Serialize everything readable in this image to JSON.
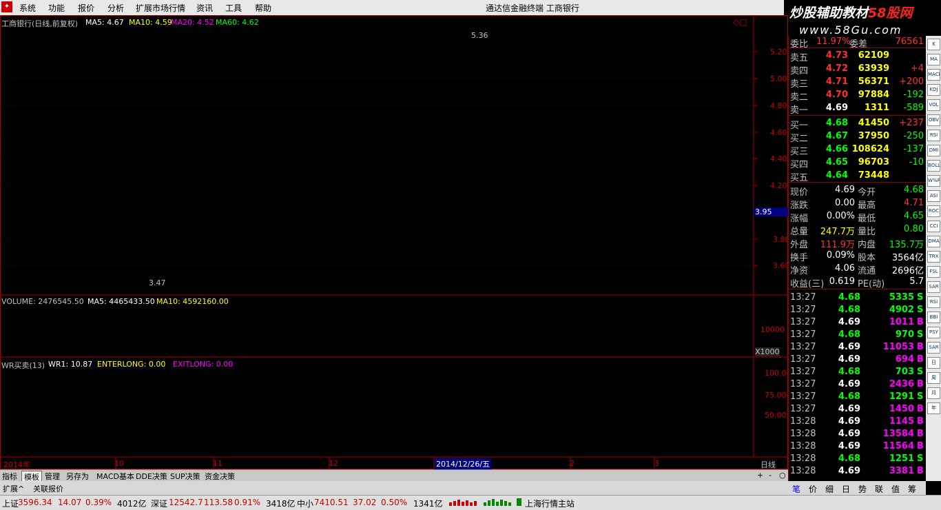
{
  "menu": [
    "系统",
    "功能",
    "报价",
    "分析",
    "扩展市场行情",
    "资讯",
    "工具",
    "帮助"
  ],
  "window_title": "通达信金融终端   工商银行",
  "banner": {
    "line1_a": "炒股辅助教材",
    "line1_b": "58股网",
    "line2": "www.58Gu.com"
  },
  "main_chart": {
    "title": "工商银行(日线,前复权)",
    "ma": [
      {
        "label": "MA5: 4.67",
        "color": "#ffffff"
      },
      {
        "label": "MA10: 4.59",
        "color": "#ffff00"
      },
      {
        "label": "MA20: 4.52",
        "color": "#ff00ff"
      },
      {
        "label": "MA60: 4.62",
        "color": "#00ff00"
      }
    ],
    "high_label": "5.36",
    "low_label": "3.47",
    "price_ticks": [
      "5.20",
      "5.00",
      "4.80",
      "4.60",
      "4.40",
      "4.20",
      "3.80",
      "3.60"
    ],
    "price_marker": "3.95",
    "corner_icons": "◇□"
  },
  "volume": {
    "label": "VOLUME: 2476545.50",
    "ma5": "MA5: 4465433.50",
    "ma10": "MA10: 4592160.00",
    "tick": "10000",
    "unit": "X1000"
  },
  "wr": {
    "title": "WR买卖(13)",
    "wr1": "WR1: 10.87",
    "enter": "ENTERLONG: 0.00",
    "exit": "EXITLONG: 0.00",
    "ticks": [
      "100.0",
      "75.00",
      "50.00"
    ]
  },
  "x_axis": {
    "labels": [
      "2014年",
      "10",
      "11",
      "12",
      "1",
      "2",
      "3"
    ],
    "cursor_date": "2014/12/26/五",
    "period": "日线"
  },
  "tabs": [
    "指标",
    "模板",
    "管理",
    "另存为",
    "MACD基本",
    "DDE决策",
    "SUP决策",
    "资金决策"
  ],
  "zoom": [
    "+",
    "-",
    "○"
  ],
  "ext_tabs": [
    "扩展^",
    "关联报价"
  ],
  "quote": {
    "header": {
      "l1": "委比",
      "v1": "11.97%",
      "l2": "委差",
      "v2": "76561"
    },
    "sells": [
      {
        "label": "卖五",
        "price": "4.73",
        "vol": "62109",
        "chg": ""
      },
      {
        "label": "卖四",
        "price": "4.72",
        "vol": "63939",
        "chg": "+4"
      },
      {
        "label": "卖三",
        "price": "4.71",
        "vol": "56371",
        "chg": "+200"
      },
      {
        "label": "卖二",
        "price": "4.70",
        "vol": "97884",
        "chg": "-192"
      },
      {
        "label": "卖一",
        "price": "4.69",
        "vol": "1311",
        "chg": "-589"
      }
    ],
    "buys": [
      {
        "label": "买一",
        "price": "4.68",
        "vol": "41450",
        "chg": "+237"
      },
      {
        "label": "买二",
        "price": "4.67",
        "vol": "37950",
        "chg": "-250"
      },
      {
        "label": "买三",
        "price": "4.66",
        "vol": "108624",
        "chg": "-137"
      },
      {
        "label": "买四",
        "price": "4.65",
        "vol": "96703",
        "chg": "-10"
      },
      {
        "label": "买五",
        "price": "4.64",
        "vol": "73448",
        "chg": ""
      }
    ],
    "stats": [
      {
        "l1": "现价",
        "v1": "4.69",
        "c1": "#ffffff",
        "l2": "今开",
        "v2": "4.68",
        "c2": "#00ff00"
      },
      {
        "l1": "涨跌",
        "v1": "0.00",
        "c1": "#ffffff",
        "l2": "最高",
        "v2": "4.71",
        "c2": "#ff3030"
      },
      {
        "l1": "涨幅",
        "v1": "0.00%",
        "c1": "#ffffff",
        "l2": "最低",
        "v2": "4.65",
        "c2": "#00ff00"
      },
      {
        "l1": "总量",
        "v1": "247.7万",
        "c1": "#ffff00",
        "l2": "量比",
        "v2": "0.80",
        "c2": "#00ff00"
      },
      {
        "l1": "外盘",
        "v1": "111.9万",
        "c1": "#ff3030",
        "l2": "内盘",
        "v2": "135.7万",
        "c2": "#00ff00"
      },
      {
        "l1": "换手",
        "v1": "0.09%",
        "c1": "#ffffff",
        "l2": "股本",
        "v2": "3564亿",
        "c2": "#ffffff"
      },
      {
        "l1": "净资",
        "v1": "4.06",
        "c1": "#ffffff",
        "l2": "流通",
        "v2": "2696亿",
        "c2": "#ffffff"
      },
      {
        "l1": "收益(三)",
        "v1": "0.619",
        "c1": "#ffffff",
        "l2": "PE(动)",
        "v2": "5.7",
        "c2": "#ffffff"
      }
    ],
    "ticks": [
      {
        "time": "13:27",
        "price": "4.68",
        "vol": "5335",
        "side": "S"
      },
      {
        "time": "13:27",
        "price": "4.68",
        "vol": "4902",
        "side": "S"
      },
      {
        "time": "13:27",
        "price": "4.69",
        "vol": "1011",
        "side": "B"
      },
      {
        "time": "13:27",
        "price": "4.68",
        "vol": "970",
        "side": "S"
      },
      {
        "time": "13:27",
        "price": "4.69",
        "vol": "11053",
        "side": "B"
      },
      {
        "time": "13:27",
        "price": "4.69",
        "vol": "694",
        "side": "B"
      },
      {
        "time": "13:27",
        "price": "4.68",
        "vol": "703",
        "side": "S"
      },
      {
        "time": "13:27",
        "price": "4.69",
        "vol": "2436",
        "side": "B"
      },
      {
        "time": "13:27",
        "price": "4.68",
        "vol": "1291",
        "side": "S"
      },
      {
        "time": "13:27",
        "price": "4.69",
        "vol": "1450",
        "side": "B"
      },
      {
        "time": "13:28",
        "price": "4.69",
        "vol": "1145",
        "side": "B"
      },
      {
        "time": "13:28",
        "price": "4.69",
        "vol": "13584",
        "side": "B"
      },
      {
        "time": "13:28",
        "price": "4.69",
        "vol": "11564",
        "side": "B"
      },
      {
        "time": "13:28",
        "price": "4.68",
        "vol": "1251",
        "side": "S"
      },
      {
        "time": "13:28",
        "price": "4.69",
        "vol": "3381",
        "side": "B"
      }
    ],
    "bottom_tabs": [
      "笔",
      "价",
      "细",
      "日",
      "势",
      "联",
      "值",
      "筹"
    ]
  },
  "sidebar_icons": [
    "K",
    "MA",
    "MACD",
    "KDJ",
    "VOL",
    "OBV",
    "RSI",
    "DMI",
    "BOLL",
    "W%R",
    "ASI",
    "ROC",
    "CCI",
    "DMA",
    "TRX",
    "FSL",
    "SAR",
    "RSI",
    "BBI",
    "PSY",
    "SAR",
    "日",
    "周",
    "月",
    "年"
  ],
  "status": {
    "sh_label": "上证",
    "sh_idx": "3596.34",
    "sh_chg": "14.07",
    "sh_pct": "0.39%",
    "sh_amt": "4012亿",
    "sz_label": "深证",
    "sz_idx": "12542.7",
    "sz_chg": "113.58",
    "sz_pct": "0.91%",
    "sz_amt": "3418亿",
    "zx_label": "中小",
    "zx_idx": "7410.51",
    "zx_chg": "37.02",
    "zx_pct": "0.50%",
    "zx_amt": "1341亿",
    "station": "上海行情主站"
  }
}
